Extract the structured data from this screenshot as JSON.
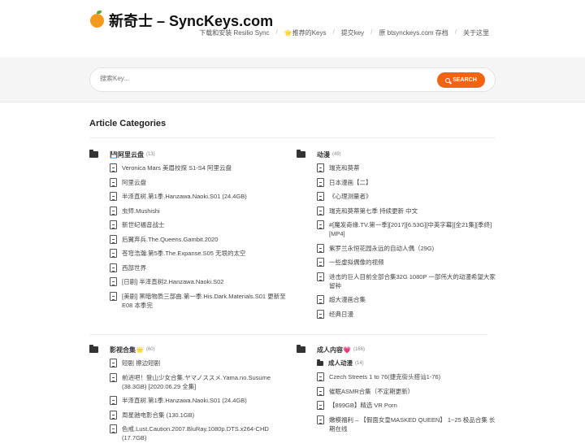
{
  "header": {
    "logo_icon": "orange-icon",
    "site_title": "新奇士 – SyncKeys.com",
    "nav": [
      {
        "label": "下载和安装 Resilio Sync"
      },
      {
        "label": "🌟推荐的Keys"
      },
      {
        "label": "提交key"
      },
      {
        "label": "原 btsynckeys.com 存档"
      },
      {
        "label": "关于这里"
      }
    ],
    "separator": "/"
  },
  "search": {
    "placeholder": "搜索Key...",
    "button_label": "SEARCH",
    "button_color": "#f06414"
  },
  "main": {
    "section_title": "Article Categories",
    "categories": [
      {
        "name": "💾阿里云盘",
        "count": "(13)",
        "items": [
          "Veronica Mars 美眉校探 S1-S4 阿里云盘",
          "阿里云盘",
          "半泽直树.第1季.Hanzawa.Naoki.S01 (24.4GB)",
          "虫师.Mushishi",
          "新世纪福音战士",
          "后翼弃兵.The.Queens.Gambit.2020",
          "苍穹浩瀚.第5季.The.Expanse.S05 无垠的太空",
          "西部世界",
          "[日剧] 半泽直树2.Hanzawa.Naoki.S02",
          "[美剧] 黑暗物质三部曲.第一季.His.Dark.Materials.S01 更新至 E08 本季完"
        ]
      },
      {
        "name": "动漫",
        "count": "(49)",
        "items": [
          "瑞克和莫蒂",
          "日本漫画【二】",
          "《心理测量者》",
          "瑞克和莫蒂第七季 持续更新 中文",
          "#[魔发奇缘.TV.第一季][2017][6.53G][中英字幕][全21集][季终][MP4]",
          "紫罗兰永恒花园永远的自动人偶（29G)",
          "一些虚拟偶像的视频",
          "进击的巨人目前全部合集32G 1080P 一部伟大的动漫希望大家留种",
          "超大漫画合集",
          "经典日漫"
        ]
      },
      {
        "name": "影视合集🌟",
        "count": "(60)",
        "items": [
          "短剧 擦边短剧",
          "前进吧！登山少女合集.ヤマノススメ.Yama.no.Susume (38.3GB) [2020.06.29 全集]",
          "半泽直树.第1季.Hanzawa.Naoki.S01 (24.4GB)",
          "周星驰电影合集 (130.1GB)",
          "色戒.Lust.Caution.2007.BluRay.1080p.DTS.x264-CHD (17.7GB)"
        ]
      },
      {
        "name": "成人内容💗",
        "count": "(166)",
        "subcategory": {
          "name": "成人动漫",
          "count": "(14)"
        },
        "items": [
          "Czech Streets 1 to 76(捷克街头搭讪1-76)",
          "催眠ASMR合集（不定期更新）",
          "【899GB】精选 VR Porn",
          "嫩模福利 – 【假面女皇MASKED QUEEN】 1~25 极品合集 长期在线"
        ]
      }
    ]
  }
}
